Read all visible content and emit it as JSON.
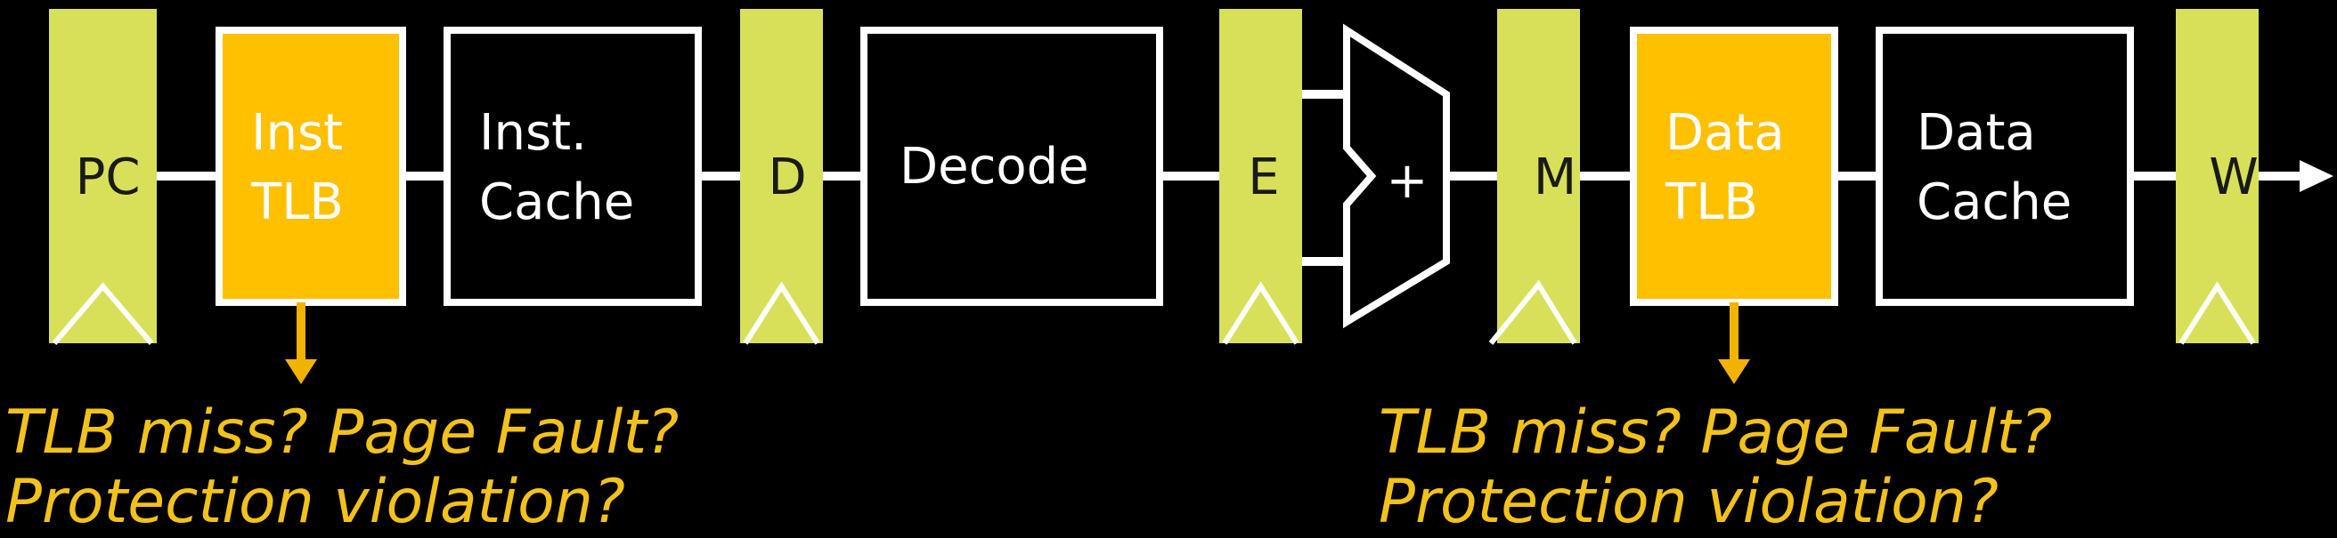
{
  "colors": {
    "background": "#000000",
    "pipeline_register": "#d8e05a",
    "tlb": "#ffc000",
    "box_stroke": "#ffffff",
    "wire": "#ffffff",
    "exception_arrow": "#f2b300",
    "note_text": "#f2c21b"
  },
  "registers": {
    "pc": "PC",
    "d": "D",
    "e": "E",
    "m": "M",
    "w": "W"
  },
  "stages": {
    "inst_tlb": {
      "line1": "Inst",
      "line2": "TLB"
    },
    "inst_cache": {
      "line1": "Inst.",
      "line2": "Cache"
    },
    "decode": {
      "label": "Decode"
    },
    "alu": {
      "label": "+"
    },
    "data_tlb": {
      "line1": "Data",
      "line2": "TLB"
    },
    "data_cache": {
      "line1": "Data",
      "line2": "Cache"
    }
  },
  "notes": {
    "inst": {
      "line1": "TLB miss? Page Fault?",
      "line2": "Protection violation?"
    },
    "data": {
      "line1": "TLB miss? Page Fault?",
      "line2": "Protection violation?"
    }
  }
}
